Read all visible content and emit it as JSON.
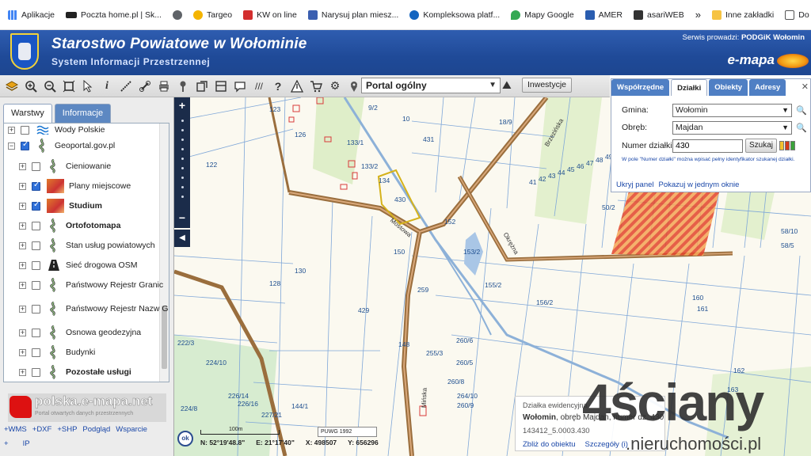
{
  "bookmarks": [
    {
      "label": "Aplikacje",
      "icon": "apps-grid-icon"
    },
    {
      "label": "Poczta home.pl | Sk...",
      "icon": "home-pl-icon"
    },
    {
      "label": "",
      "icon": "globe-icon"
    },
    {
      "label": "Targeo",
      "icon": "targeo-icon"
    },
    {
      "label": "KW on line",
      "icon": "kw-icon"
    },
    {
      "label": "Narysuj plan miesz...",
      "icon": "floorplan-icon"
    },
    {
      "label": "Kompleksowa platf...",
      "icon": "platform-icon"
    },
    {
      "label": "Mapy Google",
      "icon": "maps-pin-icon"
    },
    {
      "label": "AMER",
      "icon": "amer-icon"
    },
    {
      "label": "asariWEB",
      "icon": "asari-icon"
    }
  ],
  "bookmarks_more": "»",
  "other_bookmarks": "Inne zakładki",
  "reading_list": "Do przeczytania",
  "header": {
    "title": "Starostwo Powiatowe w Wołominie",
    "subtitle": "System Informacji Przestrzennej",
    "serwis_prefix": "Serwis prowadzi:",
    "serwis_name": "PODGiK Wołomin",
    "brand": "e-mapa"
  },
  "toolbar": {
    "profile_select": "Portal ogólny",
    "inwestycje_button": "Inwestycje"
  },
  "left_panel": {
    "tabs": [
      "Warstwy",
      "Informacje"
    ],
    "layers": [
      {
        "label": "Wody Polskie",
        "checked": false,
        "bold": false,
        "icon": "water-waves-icon"
      },
      {
        "label": "Geoportal.gov.pl",
        "checked": true,
        "bold": false,
        "icon": "layer-stack-icon"
      },
      {
        "label": "Cieniowanie",
        "checked": false,
        "bold": false,
        "icon": "layer-stack-icon"
      },
      {
        "label": "Plany miejscowe",
        "checked": true,
        "bold": false,
        "icon": "plan-map-icon"
      },
      {
        "label": "Studium",
        "checked": true,
        "bold": true,
        "icon": "plan-map-icon"
      },
      {
        "label": "Ortofotomapa",
        "checked": false,
        "bold": true,
        "icon": "layer-stack-icon"
      },
      {
        "label": "Stan usług powiatowych",
        "checked": false,
        "bold": false,
        "icon": "layer-stack-icon"
      },
      {
        "label": "Sieć drogowa OSM",
        "checked": false,
        "bold": false,
        "icon": "road-icon"
      },
      {
        "label": "Państwowy Rejestr Granic",
        "checked": false,
        "bold": false,
        "icon": "layer-stack-icon"
      },
      {
        "label": "Państwowy Rejestr Nazw Geograficznych",
        "checked": false,
        "bold": false,
        "icon": "layer-stack-icon"
      },
      {
        "label": "Osnowa geodezyjna",
        "checked": false,
        "bold": false,
        "icon": "layer-stack-icon"
      },
      {
        "label": "Budynki",
        "checked": false,
        "bold": false,
        "icon": "layer-stack-icon"
      },
      {
        "label": "Pozostałe usługi",
        "checked": false,
        "bold": true,
        "icon": "layer-stack-icon"
      }
    ],
    "logo_title": "polska.e-mapa.net",
    "logo_subtitle": "Portal otwartych danych przestrzennych",
    "links": [
      "+WMS",
      "+DXF",
      "+SHP",
      "Podgląd",
      "Wsparcie"
    ],
    "links2": [
      "+",
      "IP"
    ]
  },
  "search_panel": {
    "tabs": [
      "Współrzędne",
      "Działki",
      "Obiekty",
      "Adresy"
    ],
    "active_tab": "Działki",
    "gmina_label": "Gmina:",
    "gmina_value": "Wołomin",
    "obreb_label": "Obręb:",
    "obreb_value": "Majdan",
    "numer_label": "Numer działki:",
    "numer_value": "430",
    "search_button": "Szukaj",
    "hint": "W pole \"Numer działki\" można wpisać pełny identyfikator szukanej działki.",
    "footer_links": [
      "Ukryj panel",
      "Pokazuj w jednym oknie"
    ],
    "colors": [
      "#f2c12e",
      "#d63a1a",
      "#3aa23a"
    ]
  },
  "info_popup": {
    "title": "Działka ewidencyjna",
    "place": "Wołomin",
    "rest": ", obręb Majdan, numer dz. 430",
    "id": "143412_5.0003.430",
    "actions": [
      "Zbliż do obiektu",
      "Szczegóły (i)"
    ]
  },
  "status": {
    "ok": "ok",
    "scale": "100m",
    "crs": "PUWG 1992",
    "lat": "N: 52°19'48.8\"",
    "lon": "E: 21°17'40\"",
    "x": "X: 498507",
    "y": "Y: 656296"
  },
  "watermark": {
    "big": "4ściany",
    "small": ".nieruchomości.pl"
  },
  "map_labels": [
    "123",
    "126",
    "122",
    "133/1",
    "133/2",
    "134",
    "430",
    "9/2",
    "10",
    "431",
    "18/9",
    "128",
    "130",
    "429",
    "152",
    "150",
    "153/2",
    "259",
    "255/3",
    "260/6",
    "260/5",
    "260/8",
    "260/9",
    "264/10",
    "160",
    "161",
    "156/2",
    "155/2",
    "162",
    "163",
    "224/10",
    "222/3",
    "224/8",
    "226/16",
    "226/14",
    "227/21",
    "144/1",
    "148",
    "58/10",
    "58/5",
    "50/2",
    "41",
    "42",
    "43",
    "44",
    "45",
    "46",
    "47",
    "48",
    "49"
  ],
  "road_labels": [
    "Mińska",
    "Mostowa",
    "Okrężna",
    "Brzezińska"
  ],
  "copyright": "© Geoportal · e-mapa.net"
}
